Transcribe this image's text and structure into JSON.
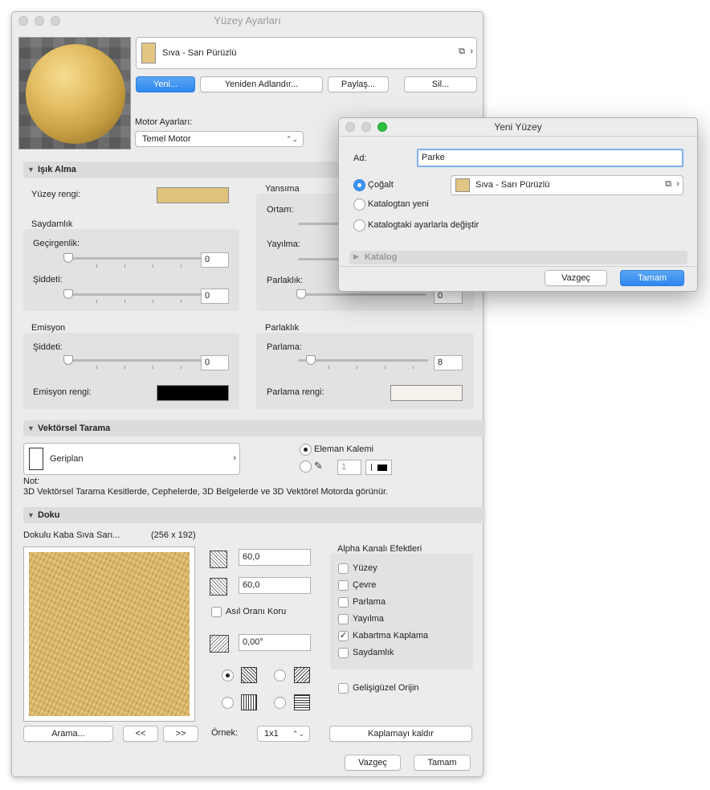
{
  "main": {
    "title": "Yüzey Ayarları",
    "surface_name": "Sıva - Sarı Pürüzlü",
    "surface_color": "#e3c582",
    "buttons": {
      "new": "Yeni...",
      "rename": "Yeniden Adlandır...",
      "share": "Paylaş...",
      "delete": "Sil..."
    },
    "engine_label": "Motor Ayarları:",
    "engine_value": "Temel Motor",
    "ok": "Tamam",
    "cancel": "Vazgeç"
  },
  "lighting": {
    "section": "Işık Alma",
    "surface_color_label": "Yüzey rengi:",
    "surface_color": "#dfc27b",
    "transparency": {
      "title": "Saydamlık",
      "transmission_label": "Geçirgenlik:",
      "transmission_value": "0",
      "intensity_label": "Şiddeti:",
      "intensity_value": "0"
    },
    "reflection": {
      "title": "Yansıma",
      "ambient_label": "Ortam:",
      "diffuse_label": "Yayılma:",
      "specular_label": "Parlaklık:",
      "specular_value": "0"
    },
    "emission": {
      "title": "Emisyon",
      "intensity_label": "Şiddeti:",
      "intensity_value": "0",
      "color_label": "Emisyon rengi:",
      "color": "#000000"
    },
    "shine": {
      "title": "Parlaklık",
      "shine_label": "Parlama:",
      "shine_value": "8",
      "color_label": "Parlama rengi:",
      "color": "#f8f2ec"
    }
  },
  "vector": {
    "section": "Vektörsel Tarama",
    "fill_name": "Geriplan",
    "pen_option": "Eleman Kalemi",
    "pen_number": "1",
    "note_label": "Not:",
    "note_text": "3D Vektörsel Tarama Kesitlerde, Cephelerde, 3D Belgelerde ve 3D Vektörel Motorda görünür."
  },
  "texture": {
    "section": "Doku",
    "name": "Dokulu Kaba Sıva Sarı...",
    "size": "(256 x 192)",
    "width": "60,0",
    "height": "60,0",
    "keep_ratio": "Asıl Oranı Koru",
    "angle": "0,00°",
    "alpha_title": "Alpha Kanalı Efektleri",
    "alpha_items": [
      {
        "label": "Yüzey",
        "checked": ""
      },
      {
        "label": "Çevre",
        "checked": ""
      },
      {
        "label": "Parlama",
        "checked": ""
      },
      {
        "label": "Yayılma",
        "checked": ""
      },
      {
        "label": "Kabartma Kaplama",
        "checked": "✓"
      },
      {
        "label": "Saydamlık",
        "checked": ""
      }
    ],
    "random_origin": "Gelişigüzel Orijin",
    "search": "Arama...",
    "prev": "<<",
    "next": ">>",
    "sample_label": "Örnek:",
    "sample_value": "1x1",
    "remove": "Kaplamayı kaldır"
  },
  "dialog": {
    "title": "Yeni Yüzey",
    "name_label": "Ad:",
    "name_value": "Parke",
    "duplicate": "Çoğalt",
    "duplicate_source": "Sıva - Sarı Pürüzlü",
    "from_catalog": "Katalogtan yeni",
    "replace_catalog": "Katalogtaki ayarlarla değiştir",
    "catalog": "Katalog",
    "cancel": "Vazgeç",
    "ok": "Tamam"
  },
  "icons": {
    "material_picker": "material-picker-icon",
    "chevron_right": "chevron-right-icon",
    "pen": "pen-icon"
  }
}
